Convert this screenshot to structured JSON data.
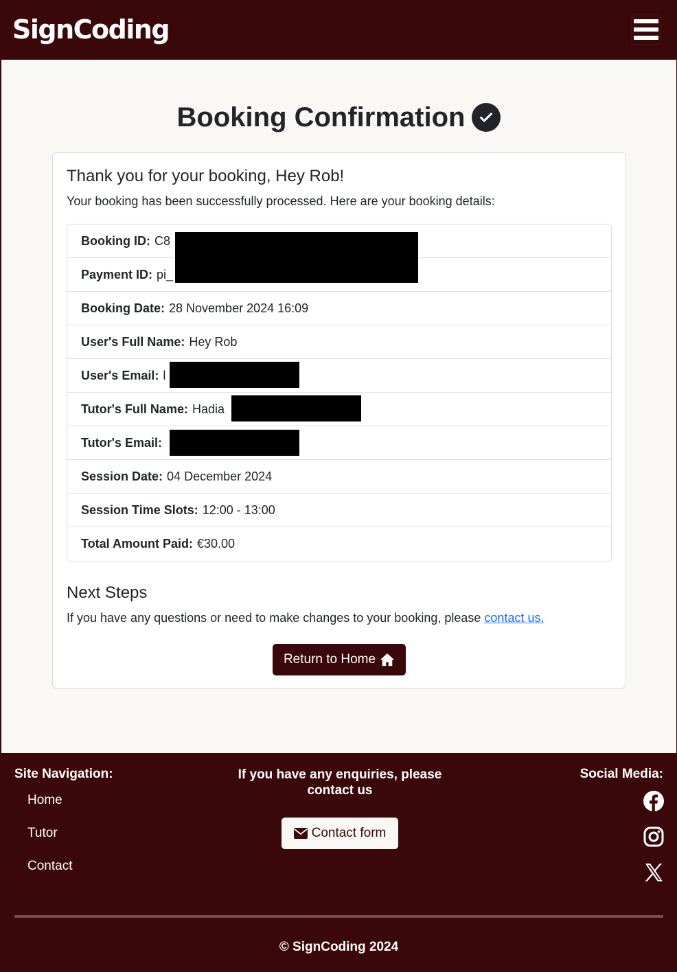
{
  "navbar": {
    "brand": "SignCoding",
    "menu_icon": "hamburger-icon"
  },
  "page": {
    "title": "Booking Confirmation",
    "title_icon": "check-circle-icon"
  },
  "card": {
    "heading": "Thank you for your booking, Hey Rob!",
    "intro": "Your booking has been successfully processed. Here are your booking details:",
    "details": [
      {
        "label": "Booking ID:",
        "value": "C8"
      },
      {
        "label": "Payment ID:",
        "value": "pi_"
      },
      {
        "label": "Booking Date:",
        "value": "28 November 2024 16:09"
      },
      {
        "label": "User's Full Name:",
        "value": "Hey Rob"
      },
      {
        "label": "User's Email:",
        "value": "l"
      },
      {
        "label": "Tutor's Full Name:",
        "value": "Hadia"
      },
      {
        "label": "Tutor's Email:",
        "value": ""
      },
      {
        "label": "Session Date:",
        "value": "04 December 2024"
      },
      {
        "label": "Session Time Slots:",
        "value": "12:00 - 13:00"
      },
      {
        "label": "Total Amount Paid:",
        "value": "€30.00"
      }
    ],
    "next_heading": "Next Steps",
    "next_text": "If you have any questions or need to make changes to your booking, please",
    "next_link": "contact us.",
    "home_button": "Return to Home"
  },
  "footer": {
    "nav_heading": "Site Navigation:",
    "nav_items": [
      "Home",
      "Tutor",
      "Contact"
    ],
    "contact_text": "If you have any enquiries, please contact us",
    "contact_button": "Contact form",
    "social_heading": "Social Media:",
    "social_icons": [
      "facebook-icon",
      "instagram-icon",
      "x-icon"
    ],
    "copyright": "© SignCoding 2024"
  },
  "colors": {
    "brand": "#3a080a",
    "background": "#faf8f4",
    "link": "#0d6efd"
  }
}
